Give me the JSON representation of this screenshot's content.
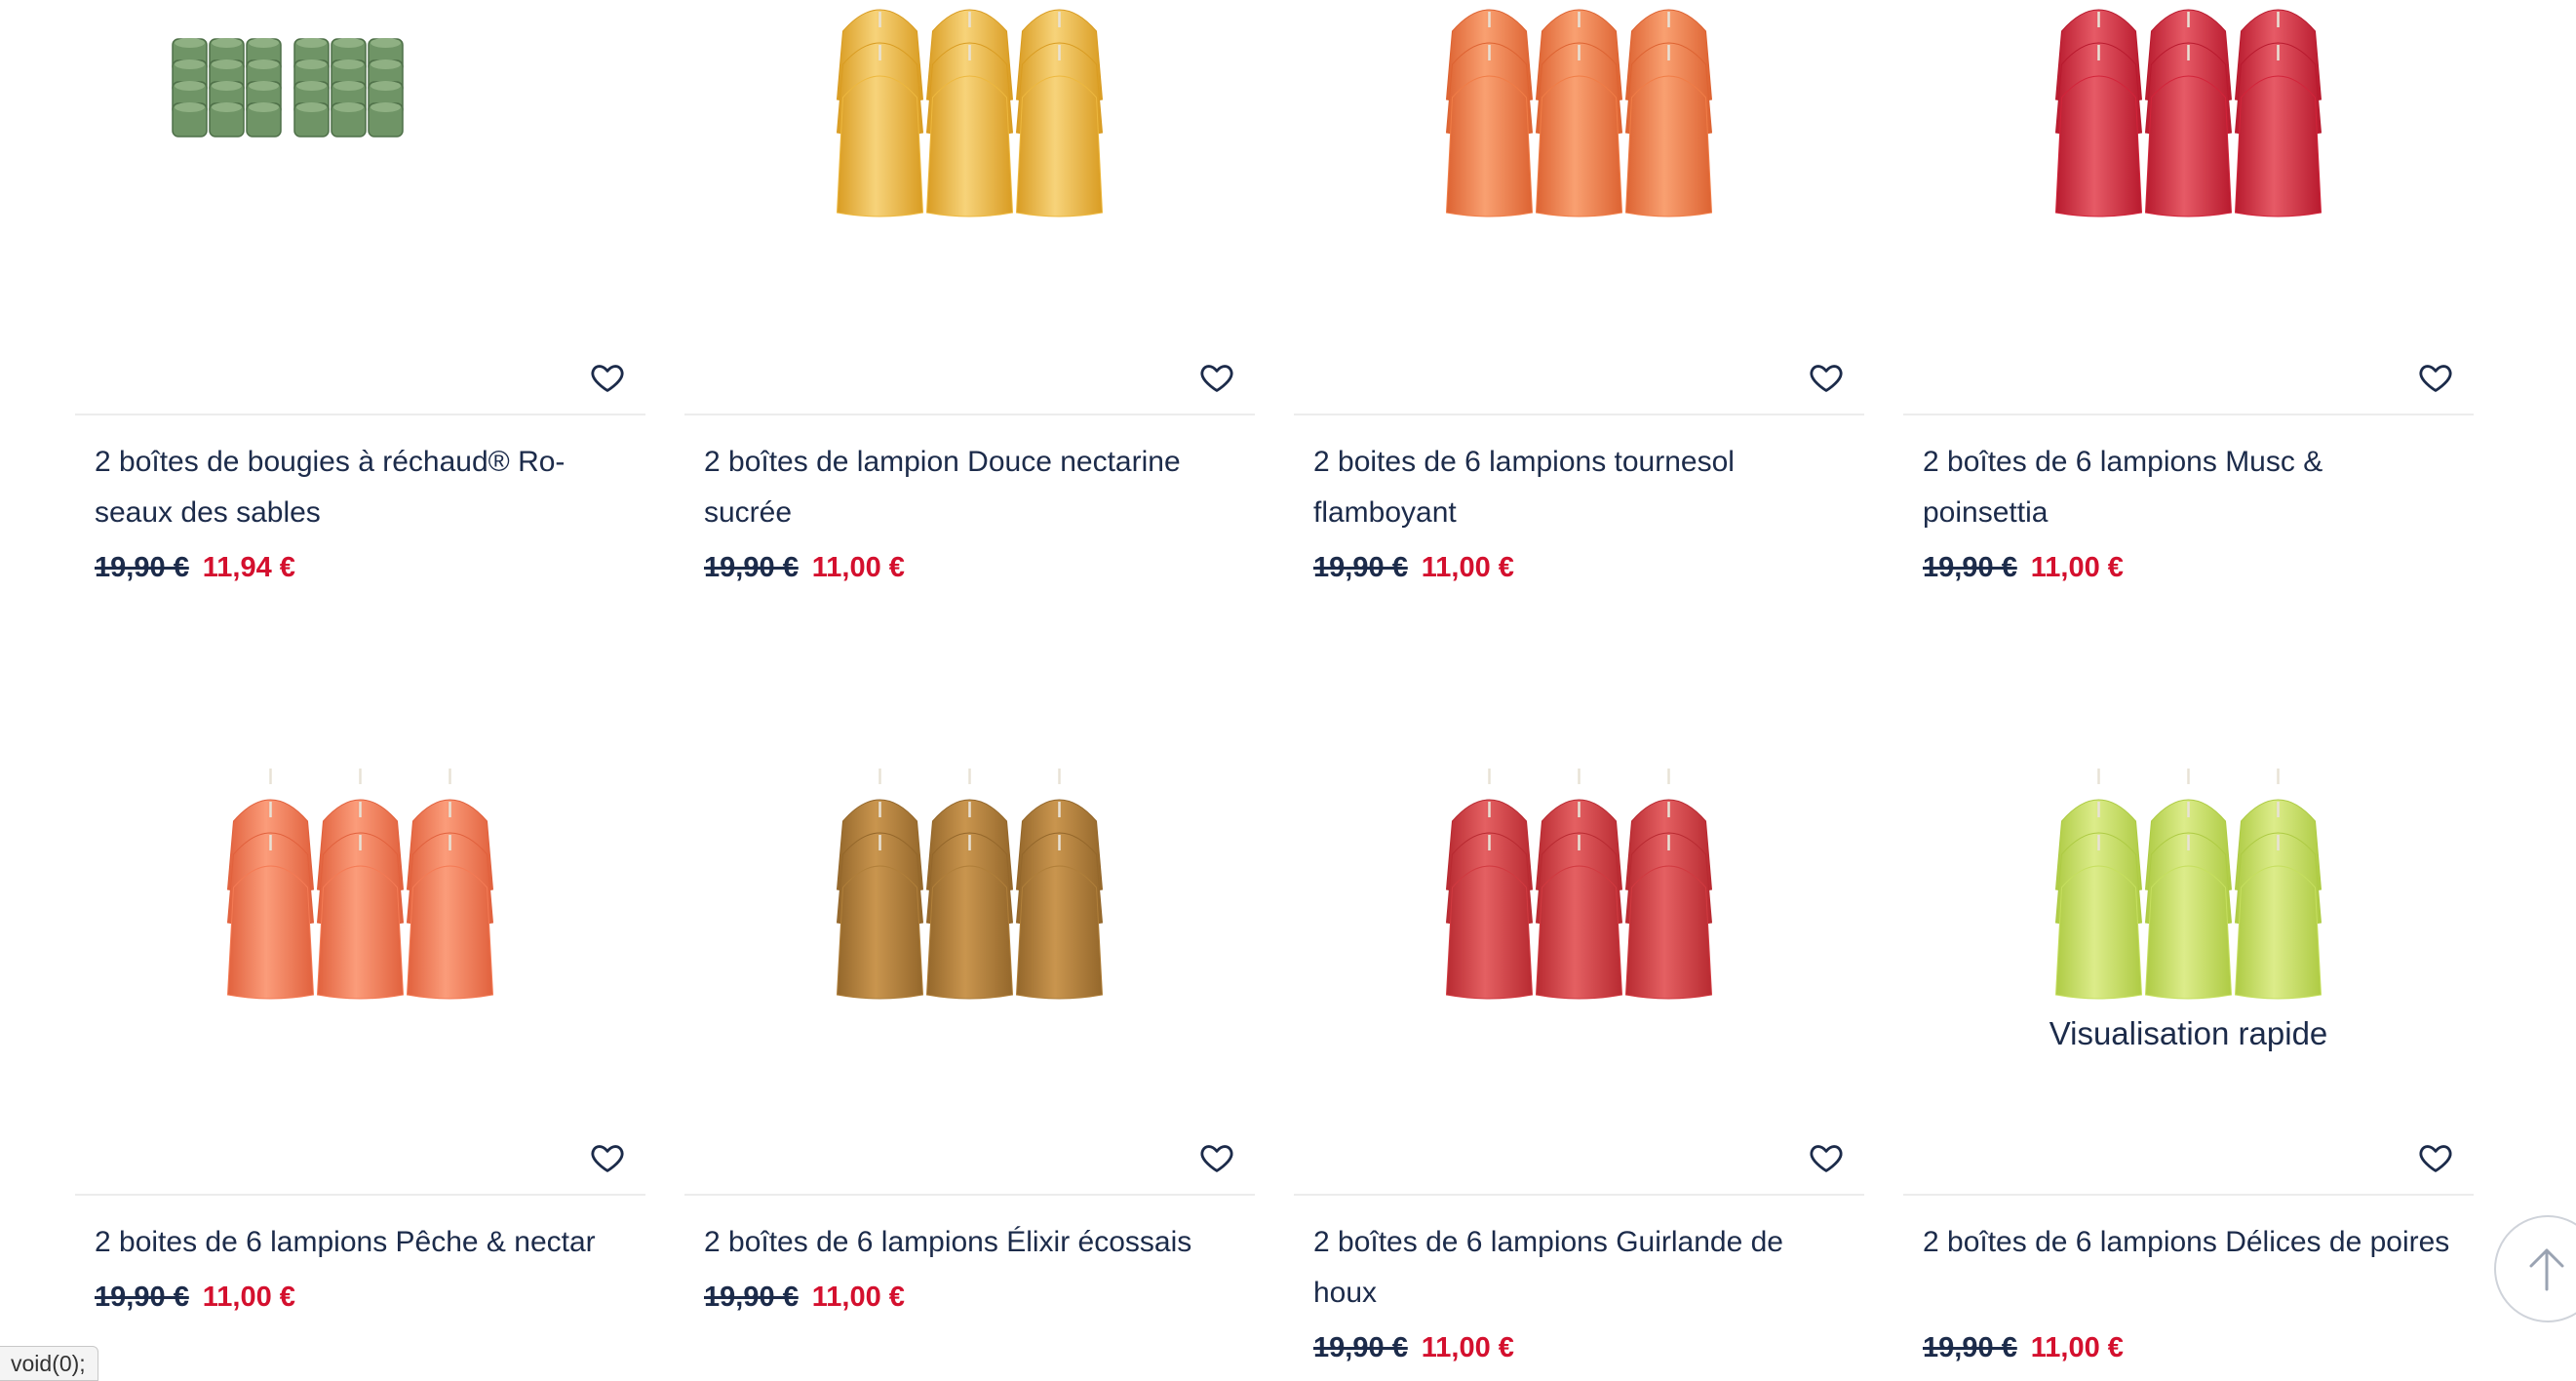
{
  "products": [
    {
      "title": "2 boîtes de bougies à réchaud® Ro-seaux des sables",
      "old_price": "19,90 €",
      "new_price": "11,94 €",
      "image": "green-tealights-icon"
    },
    {
      "title": "2 boîtes de lampion Douce nectarine sucrée",
      "old_price": "19,90 €",
      "new_price": "11,00 €",
      "image": "yellow-votives-icon"
    },
    {
      "title": "2 boites de 6 lampions tournesol flamboyant",
      "old_price": "19,90 €",
      "new_price": "11,00 €",
      "image": "orange-votives-icon"
    },
    {
      "title": "2 boîtes de 6 lampions Musc & poinsettia",
      "old_price": "19,90 €",
      "new_price": "11,00 €",
      "image": "red-votives-icon"
    },
    {
      "title": "2 boites de 6 lampions Pêche & nectar",
      "old_price": "19,90 €",
      "new_price": "11,00 €",
      "image": "peach-votives-icon"
    },
    {
      "title": "2 boîtes de 6 lampions Élixir écossais",
      "old_price": "19,90 €",
      "new_price": "11,00 €",
      "image": "brown-votives-icon"
    },
    {
      "title": "2 boîtes de 6 lampions Guirlande de houx",
      "old_price": "19,90 €",
      "new_price": "11,00 €",
      "image": "crimson-votives-icon"
    },
    {
      "title": "2 boîtes de 6 lampions Délices de poires",
      "old_price": "19,90 €",
      "new_price": "11,00 €",
      "image": "lime-votives-icon",
      "overlay": "Visualisation rapide"
    }
  ],
  "status_bar": {
    "text": "void(0);"
  },
  "colors": {
    "old_price": "#1c2b4a",
    "sale_price": "#d4102e",
    "text": "#1c2b4a"
  }
}
